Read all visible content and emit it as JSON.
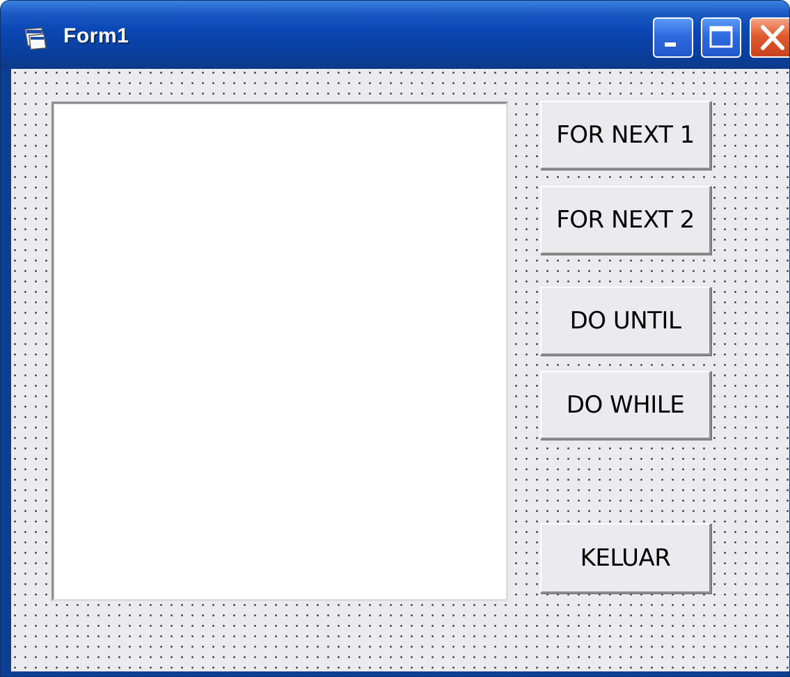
{
  "window": {
    "title": "Form1",
    "controls": [
      "minimize-icon",
      "maximize-icon",
      "close-icon"
    ],
    "colors": {
      "titlebar": "#0b49b6",
      "client_background": "#ebeaee",
      "close_button": "#e05a2e"
    }
  },
  "form": {
    "textbox": {
      "value": ""
    },
    "buttons": {
      "for_next_1": "FOR NEXT 1",
      "for_next_2": "FOR NEXT 2",
      "do_until": "DO UNTIL",
      "do_while": "DO WHILE",
      "keluar": "KELUAR"
    }
  }
}
